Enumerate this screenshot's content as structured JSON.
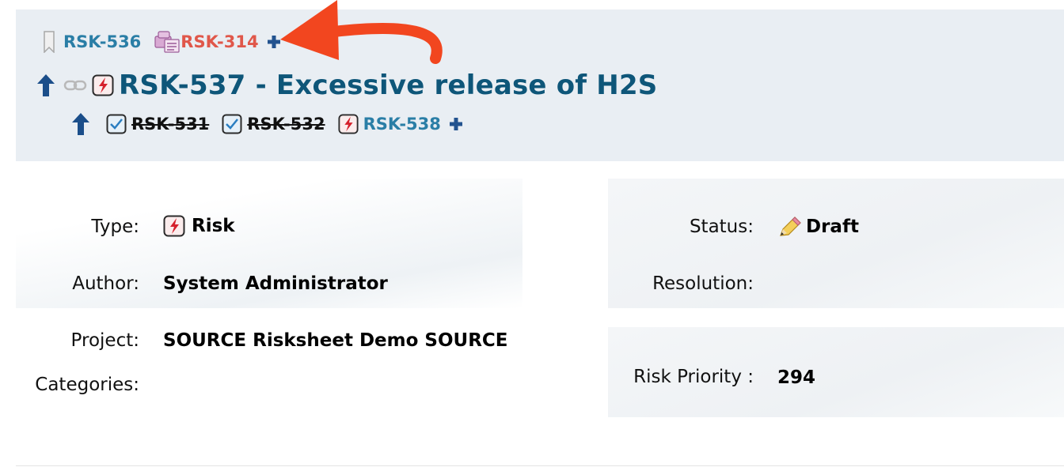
{
  "links": {
    "bookmark_icon": "bookmark-icon",
    "parent_link": "RSK-536",
    "package_icon": "package-icon",
    "linked_red": "RSK-314",
    "add_icon": "plus-icon"
  },
  "item": {
    "up_icon": "arrow-up-icon",
    "link_icon": "chain-link-icon",
    "type_icon": "risk-icon",
    "title": "RSK-537 - Excessive release of H2S"
  },
  "children": [
    {
      "id": "RSK-531",
      "icon": "checked-task-icon",
      "resolved": true
    },
    {
      "id": "RSK-532",
      "icon": "checked-task-icon",
      "resolved": true
    },
    {
      "id": "RSK-538",
      "icon": "risk-icon",
      "resolved": false
    }
  ],
  "details": {
    "type_label": "Type:",
    "type_value": "Risk",
    "author_label": "Author:",
    "author_value": "System Administrator",
    "project_label": "Project:",
    "project_value": "SOURCE Risksheet Demo SOURCE",
    "categories_label": "Categories:",
    "categories_value": "",
    "status_label": "Status:",
    "status_value": "Draft",
    "resolution_label": "Resolution:",
    "resolution_value": "",
    "risk_priority_label": "Risk Priority :",
    "risk_priority_value": "294"
  },
  "colors": {
    "header_bg": "#e9eef3",
    "title": "#0e5679",
    "link": "#2a7ea6",
    "red_link": "#e0574a",
    "annotation_arrow": "#f2461f"
  }
}
